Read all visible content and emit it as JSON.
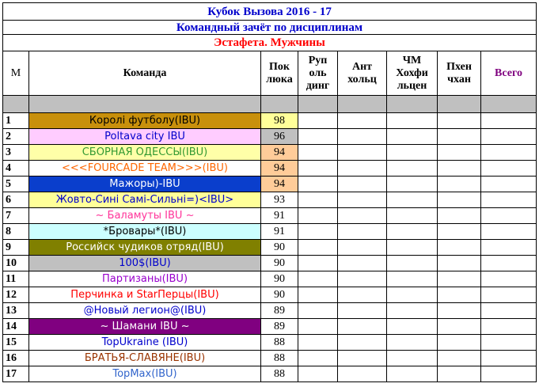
{
  "title_line1": "Кубок Вызова 2016 - 17",
  "title_line2": "Командный зачёт по дисциплинам",
  "discipline": "Эстафета. Мужчины",
  "headers": {
    "m": "М",
    "team": "Команда",
    "pok_line1": "Пок",
    "pok_line2": "люка",
    "rup_line1": "Руп",
    "rup_line2": "оль",
    "rup_line3": "динг",
    "ant_line1": "Ант",
    "ant_line2": "хольц",
    "chm_line1": "ЧМ",
    "chm_line2": "Хохфи",
    "chm_line3": "льцен",
    "pkh_line1": "Пхен",
    "pkh_line2": "чхан",
    "total": "Всего"
  },
  "rows": [
    {
      "rank": "1",
      "team": "Королі футболу(IBU)",
      "points": "98",
      "team_bg": "#c8900c",
      "team_color": "#000000",
      "pts_bg": "#ffff99"
    },
    {
      "rank": "2",
      "team": "Poltava city IBU",
      "points": "96",
      "team_bg": "#ffccff",
      "team_color": "#0000cc",
      "pts_bg": "#c0c0c0"
    },
    {
      "rank": "3",
      "team": "СБОРНАЯ ОДЕССЫ(IBU)",
      "points": "94",
      "team_bg": "#ffffa8",
      "team_color": "#339933",
      "pts_bg": "#ffcc99"
    },
    {
      "rank": "4",
      "team": "<<<FOURCADE  TEAM>>>(IBU)",
      "points": "94",
      "team_bg": "#ffffff",
      "team_color": "#ff6600",
      "pts_bg": "#ffcc99"
    },
    {
      "rank": "5",
      "team": "Мажоры)-IBU",
      "points": "94",
      "team_bg": "#0a3ecc",
      "team_color": "#ffffff",
      "pts_bg": "#ffcc99"
    },
    {
      "rank": "6",
      "team": "Жовто-Сині Самі-Сильні=)<IBU>",
      "points": "93",
      "team_bg": "#ffff99",
      "team_color": "#0000cc",
      "pts_bg": "#ffffff"
    },
    {
      "rank": "7",
      "team": "~ Баламуты IBU ~",
      "points": "91",
      "team_bg": "#ffffff",
      "team_color": "#ff3399",
      "pts_bg": "#ffffff"
    },
    {
      "rank": "8",
      "team": "*Бровары*(IBU)",
      "points": "91",
      "team_bg": "#ccffff",
      "team_color": "#000000",
      "pts_bg": "#ffffff"
    },
    {
      "rank": "9",
      "team": "Российск чудиков отряд(IBU)",
      "points": "90",
      "team_bg": "#808000",
      "team_color": "#ffffff",
      "pts_bg": "#ffffff"
    },
    {
      "rank": "10",
      "team": "100$(IBU)",
      "points": "90",
      "team_bg": "#c0c0c0",
      "team_color": "#0000cc",
      "pts_bg": "#ffffff"
    },
    {
      "rank": "11",
      "team": "Партизаны(IBU)",
      "points": "90",
      "team_bg": "#ffffff",
      "team_color": "#9900cc",
      "pts_bg": "#ffffff"
    },
    {
      "rank": "12",
      "team": "Перчинка и StarПерцы(IBU)",
      "points": "90",
      "team_bg": "#ffffff",
      "team_color": "#ff0000",
      "pts_bg": "#ffffff"
    },
    {
      "rank": "13",
      "team": "@Новый легион@(IBU)",
      "points": "89",
      "team_bg": "#ffffff",
      "team_color": "#0000cc",
      "pts_bg": "#ffffff"
    },
    {
      "rank": "14",
      "team": "~ Шамани IBU ~",
      "points": "89",
      "team_bg": "#800080",
      "team_color": "#ffffff",
      "pts_bg": "#ffffff"
    },
    {
      "rank": "15",
      "team": "TopUkraine (IBU)",
      "points": "88",
      "team_bg": "#ffffff",
      "team_color": "#0000cc",
      "pts_bg": "#ffffff"
    },
    {
      "rank": "16",
      "team": "БРАТЬЯ-СЛАВЯНЕ(IBU)",
      "points": "88",
      "team_bg": "#ffffff",
      "team_color": "#993300",
      "pts_bg": "#ffffff"
    },
    {
      "rank": "17",
      "team": "TopMax(IBU)",
      "points": "88",
      "team_bg": "#ffffff",
      "team_color": "#3366cc",
      "pts_bg": "#ffffff"
    }
  ]
}
